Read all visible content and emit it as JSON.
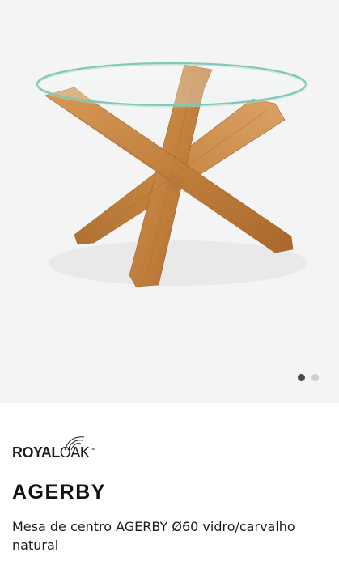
{
  "gallery": {
    "image_alt": "AGERBY coffee table with round glass top and crossed oak legs",
    "slides": 2,
    "active_slide": 1
  },
  "brand": {
    "royal": "ROYAL",
    "oak": "OAK",
    "mark": "™"
  },
  "product": {
    "name": "AGERBY",
    "description": "Mesa de centro AGERBY Ø60 vidro/carvalho natural"
  },
  "colors": {
    "gallery_bg": "#f4f4f4",
    "wood": "#c98a45",
    "glass_edge": "#7fc9b4",
    "dot_active": "#4a4a4a",
    "dot_inactive": "#cfcfcf"
  }
}
